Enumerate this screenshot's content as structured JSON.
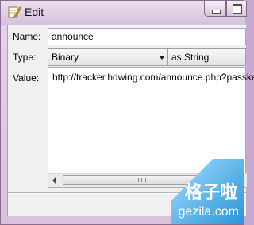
{
  "window": {
    "title": "Edit"
  },
  "form": {
    "name_label": "Name:",
    "name_value": "announce",
    "type_label": "Type:",
    "type_value": "Binary",
    "format_value": "as String",
    "value_label": "Value:",
    "value_text": "http://tracker.hdwing.com/announce.php?passkey"
  },
  "watermark": {
    "brand_cn": "格子啦",
    "brand_url": "gezila.com"
  }
}
